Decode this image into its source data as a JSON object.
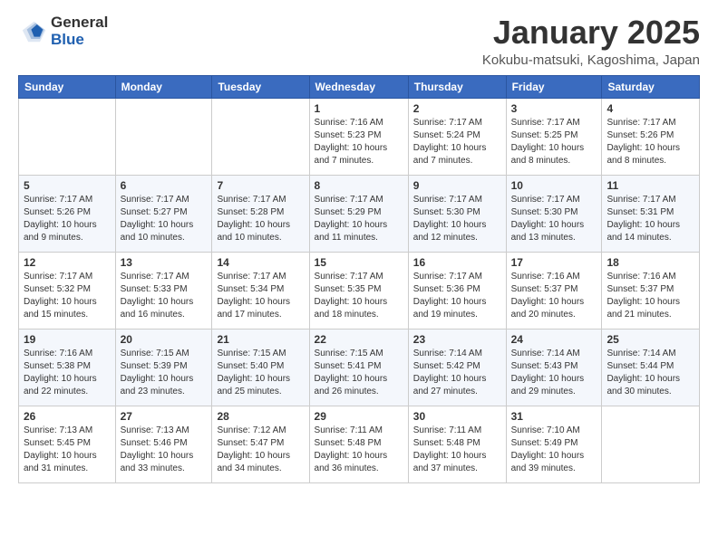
{
  "header": {
    "logo_general": "General",
    "logo_blue": "Blue",
    "month_title": "January 2025",
    "location": "Kokubu-matsuki, Kagoshima, Japan"
  },
  "days_of_week": [
    "Sunday",
    "Monday",
    "Tuesday",
    "Wednesday",
    "Thursday",
    "Friday",
    "Saturday"
  ],
  "weeks": [
    [
      {
        "day": "",
        "info": ""
      },
      {
        "day": "",
        "info": ""
      },
      {
        "day": "",
        "info": ""
      },
      {
        "day": "1",
        "info": "Sunrise: 7:16 AM\nSunset: 5:23 PM\nDaylight: 10 hours\nand 7 minutes."
      },
      {
        "day": "2",
        "info": "Sunrise: 7:17 AM\nSunset: 5:24 PM\nDaylight: 10 hours\nand 7 minutes."
      },
      {
        "day": "3",
        "info": "Sunrise: 7:17 AM\nSunset: 5:25 PM\nDaylight: 10 hours\nand 8 minutes."
      },
      {
        "day": "4",
        "info": "Sunrise: 7:17 AM\nSunset: 5:26 PM\nDaylight: 10 hours\nand 8 minutes."
      }
    ],
    [
      {
        "day": "5",
        "info": "Sunrise: 7:17 AM\nSunset: 5:26 PM\nDaylight: 10 hours\nand 9 minutes."
      },
      {
        "day": "6",
        "info": "Sunrise: 7:17 AM\nSunset: 5:27 PM\nDaylight: 10 hours\nand 10 minutes."
      },
      {
        "day": "7",
        "info": "Sunrise: 7:17 AM\nSunset: 5:28 PM\nDaylight: 10 hours\nand 10 minutes."
      },
      {
        "day": "8",
        "info": "Sunrise: 7:17 AM\nSunset: 5:29 PM\nDaylight: 10 hours\nand 11 minutes."
      },
      {
        "day": "9",
        "info": "Sunrise: 7:17 AM\nSunset: 5:30 PM\nDaylight: 10 hours\nand 12 minutes."
      },
      {
        "day": "10",
        "info": "Sunrise: 7:17 AM\nSunset: 5:30 PM\nDaylight: 10 hours\nand 13 minutes."
      },
      {
        "day": "11",
        "info": "Sunrise: 7:17 AM\nSunset: 5:31 PM\nDaylight: 10 hours\nand 14 minutes."
      }
    ],
    [
      {
        "day": "12",
        "info": "Sunrise: 7:17 AM\nSunset: 5:32 PM\nDaylight: 10 hours\nand 15 minutes."
      },
      {
        "day": "13",
        "info": "Sunrise: 7:17 AM\nSunset: 5:33 PM\nDaylight: 10 hours\nand 16 minutes."
      },
      {
        "day": "14",
        "info": "Sunrise: 7:17 AM\nSunset: 5:34 PM\nDaylight: 10 hours\nand 17 minutes."
      },
      {
        "day": "15",
        "info": "Sunrise: 7:17 AM\nSunset: 5:35 PM\nDaylight: 10 hours\nand 18 minutes."
      },
      {
        "day": "16",
        "info": "Sunrise: 7:17 AM\nSunset: 5:36 PM\nDaylight: 10 hours\nand 19 minutes."
      },
      {
        "day": "17",
        "info": "Sunrise: 7:16 AM\nSunset: 5:37 PM\nDaylight: 10 hours\nand 20 minutes."
      },
      {
        "day": "18",
        "info": "Sunrise: 7:16 AM\nSunset: 5:37 PM\nDaylight: 10 hours\nand 21 minutes."
      }
    ],
    [
      {
        "day": "19",
        "info": "Sunrise: 7:16 AM\nSunset: 5:38 PM\nDaylight: 10 hours\nand 22 minutes."
      },
      {
        "day": "20",
        "info": "Sunrise: 7:15 AM\nSunset: 5:39 PM\nDaylight: 10 hours\nand 23 minutes."
      },
      {
        "day": "21",
        "info": "Sunrise: 7:15 AM\nSunset: 5:40 PM\nDaylight: 10 hours\nand 25 minutes."
      },
      {
        "day": "22",
        "info": "Sunrise: 7:15 AM\nSunset: 5:41 PM\nDaylight: 10 hours\nand 26 minutes."
      },
      {
        "day": "23",
        "info": "Sunrise: 7:14 AM\nSunset: 5:42 PM\nDaylight: 10 hours\nand 27 minutes."
      },
      {
        "day": "24",
        "info": "Sunrise: 7:14 AM\nSunset: 5:43 PM\nDaylight: 10 hours\nand 29 minutes."
      },
      {
        "day": "25",
        "info": "Sunrise: 7:14 AM\nSunset: 5:44 PM\nDaylight: 10 hours\nand 30 minutes."
      }
    ],
    [
      {
        "day": "26",
        "info": "Sunrise: 7:13 AM\nSunset: 5:45 PM\nDaylight: 10 hours\nand 31 minutes."
      },
      {
        "day": "27",
        "info": "Sunrise: 7:13 AM\nSunset: 5:46 PM\nDaylight: 10 hours\nand 33 minutes."
      },
      {
        "day": "28",
        "info": "Sunrise: 7:12 AM\nSunset: 5:47 PM\nDaylight: 10 hours\nand 34 minutes."
      },
      {
        "day": "29",
        "info": "Sunrise: 7:11 AM\nSunset: 5:48 PM\nDaylight: 10 hours\nand 36 minutes."
      },
      {
        "day": "30",
        "info": "Sunrise: 7:11 AM\nSunset: 5:48 PM\nDaylight: 10 hours\nand 37 minutes."
      },
      {
        "day": "31",
        "info": "Sunrise: 7:10 AM\nSunset: 5:49 PM\nDaylight: 10 hours\nand 39 minutes."
      },
      {
        "day": "",
        "info": ""
      }
    ]
  ]
}
